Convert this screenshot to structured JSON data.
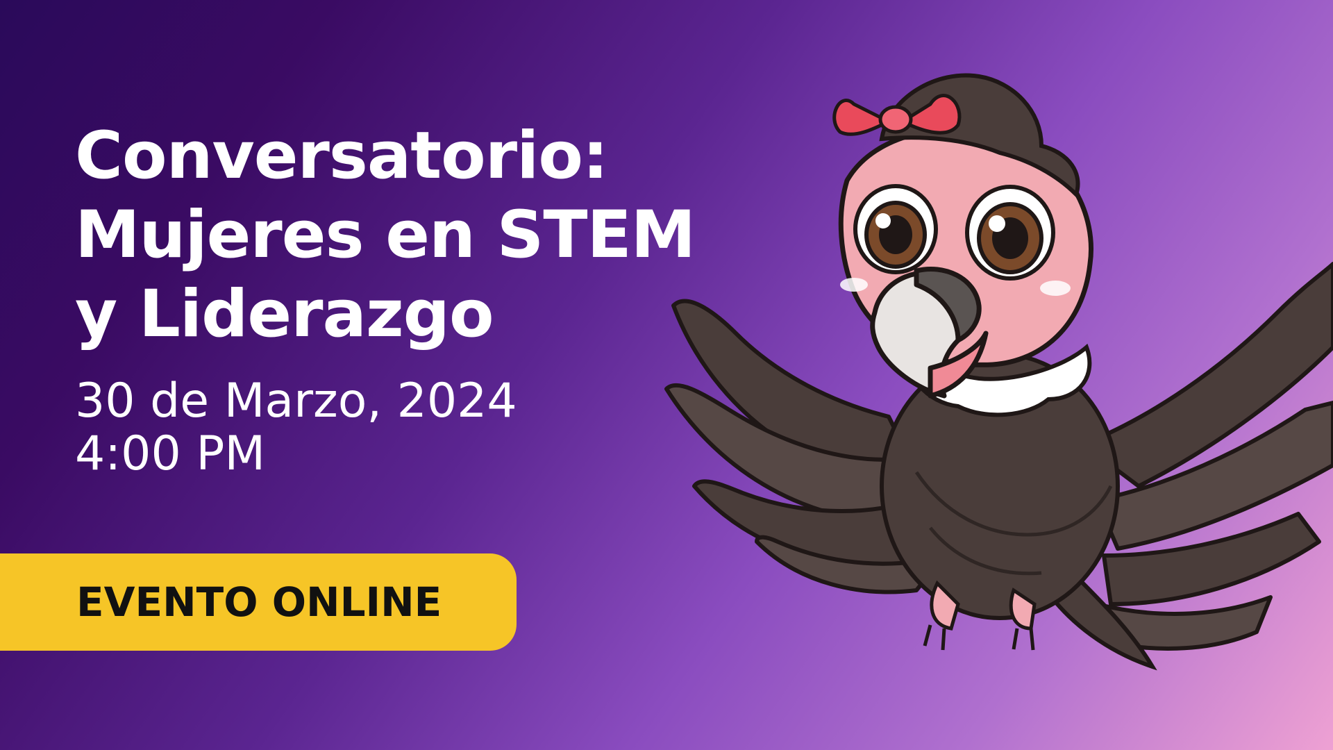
{
  "event": {
    "title_lines": [
      "Conversatorio:",
      "Mujeres en STEM",
      "y Liderazgo"
    ],
    "date": "30 de Marzo, 2024",
    "time": "4:00 PM",
    "badge": "EVENTO ONLINE"
  },
  "illustration": {
    "subject": "cartoon-condor-mascot",
    "icon": "condor-icon"
  },
  "colors": {
    "background_start": "#2a0a5a",
    "background_mid": "#8a4cbf",
    "background_end": "#eea1d3",
    "text": "#ffffff",
    "badge_background": "#f6c527",
    "badge_text": "#111111",
    "bow": "#e94a5b",
    "feathers": "#4a3d3a",
    "face": "#f2aab2"
  }
}
